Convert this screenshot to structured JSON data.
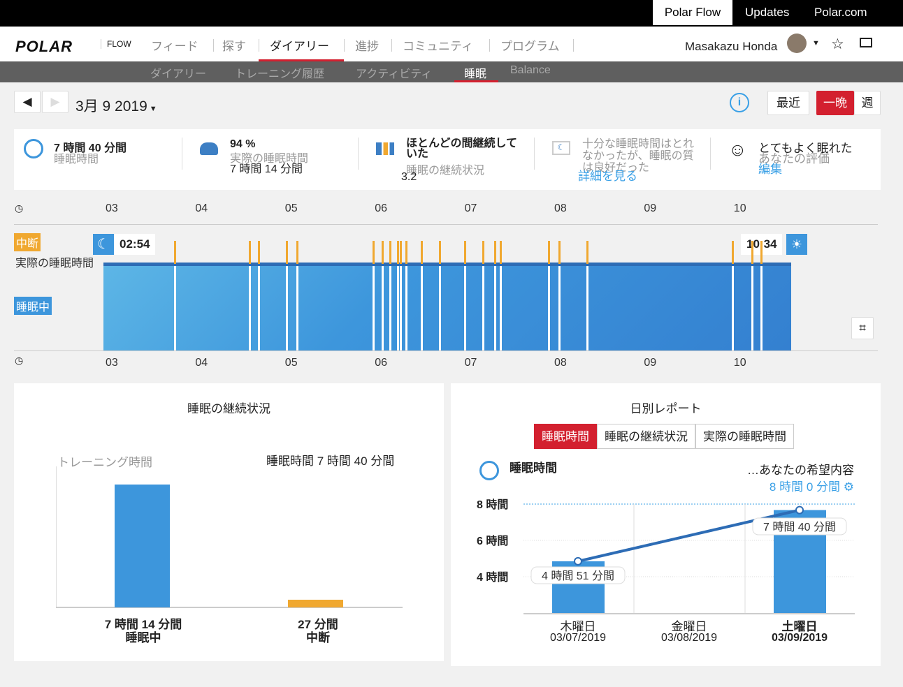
{
  "topbar": {
    "items": [
      "Polar Flow",
      "Updates",
      "Polar.com"
    ]
  },
  "nav": {
    "logo": "POLAR",
    "logo_sub": "FLOW",
    "items": [
      "フィード",
      "探す",
      "ダイアリー",
      "進捗",
      "コミュニティ",
      "プログラム"
    ],
    "active": 2,
    "user": "Masakazu Honda"
  },
  "subnav": {
    "items": [
      "ダイアリー",
      "トレーニング履歴",
      "アクティビティ",
      "睡眠",
      "Balance"
    ],
    "active": 3
  },
  "datebar": {
    "date": "3月 9 2019",
    "recent": "最近",
    "night": "一晩",
    "week": "週"
  },
  "stats": [
    {
      "icon": "sleep-time-icon",
      "value": "7 時間 40 分間",
      "label": "睡眠時間"
    },
    {
      "icon": "actual-sleep-icon",
      "value": "94 %",
      "label": "実際の睡眠時間",
      "extra": "7 時間 14 分間"
    },
    {
      "icon": "continuity-icon",
      "value": "ほとんどの間継続していた",
      "label": "睡眠の継続状況",
      "extra": "3.2"
    },
    {
      "icon": "feedback-icon",
      "label": "十分な睡眠時間はとれなかったが、睡眠の質は良好だった",
      "link": "詳細を見る"
    },
    {
      "icon": "smiley-icon",
      "value": "とてもよく眠れた",
      "label": "あなたの評価",
      "link": "編集"
    }
  ],
  "hypnogram": {
    "hours": [
      "03",
      "04",
      "05",
      "06",
      "07",
      "08",
      "09",
      "10"
    ],
    "start": "02:54",
    "end": "10:34",
    "label_interrupt": "中断",
    "label_actual": "実際の睡眠時間",
    "label_sleep": "睡眠中",
    "interruptions": [
      "03:41",
      "04:31",
      "04:37",
      "04:56",
      "05:03",
      "05:54",
      "06:00",
      "06:05",
      "06:10",
      "06:12",
      "06:16",
      "06:26",
      "06:38",
      "06:55",
      "07:07",
      "07:15",
      "07:19",
      "07:51",
      "07:58",
      "08:17",
      "09:54",
      "10:07",
      "10:13"
    ],
    "colors": {
      "sleep": "#3d96dc",
      "interrupt": "#f0a830"
    }
  },
  "continuity": {
    "title": "睡眠の継続状況",
    "left_label": "トレーニング時間",
    "right_label": "睡眠時間 7 時間 40 分間",
    "chart_data": {
      "type": "bar",
      "categories": [
        "睡眠中",
        "中断"
      ],
      "values_min": [
        434,
        27
      ],
      "value_labels": [
        "7 時間 14 分間",
        "27 分間"
      ],
      "colors": [
        "#3d96dc",
        "#f0a830"
      ]
    }
  },
  "daily": {
    "title": "日別レポート",
    "tabs": [
      "睡眠時間",
      "睡眠の継続状況",
      "実際の睡眠時間"
    ],
    "active_tab": 0,
    "metric": "睡眠時間",
    "goal_label": "…あなたの希望内容",
    "goal": "8 時間 0 分間",
    "chart_data": {
      "type": "bar",
      "categories": [
        "木曜日",
        "金曜日",
        "土曜日"
      ],
      "dates": [
        "03/07/2019",
        "03/08/2019",
        "03/09/2019"
      ],
      "values_h": [
        4.85,
        null,
        7.67
      ],
      "value_labels": [
        "4 時間 51 分間",
        "",
        "7 時間 40 分間"
      ],
      "yticks": [
        "8 時間",
        "6 時間",
        "4 時間"
      ],
      "goal_h": 8
    }
  }
}
